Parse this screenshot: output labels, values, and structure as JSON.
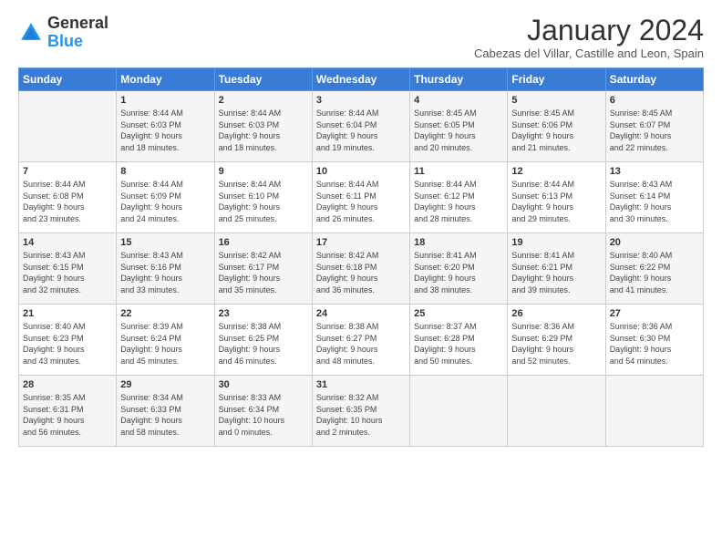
{
  "logo": {
    "line1": "General",
    "line2": "Blue"
  },
  "title": "January 2024",
  "subtitle": "Cabezas del Villar, Castille and Leon, Spain",
  "days_header": [
    "Sunday",
    "Monday",
    "Tuesday",
    "Wednesday",
    "Thursday",
    "Friday",
    "Saturday"
  ],
  "weeks": [
    [
      {
        "day": "",
        "info": ""
      },
      {
        "day": "1",
        "info": "Sunrise: 8:44 AM\nSunset: 6:03 PM\nDaylight: 9 hours\nand 18 minutes."
      },
      {
        "day": "2",
        "info": "Sunrise: 8:44 AM\nSunset: 6:03 PM\nDaylight: 9 hours\nand 18 minutes."
      },
      {
        "day": "3",
        "info": "Sunrise: 8:44 AM\nSunset: 6:04 PM\nDaylight: 9 hours\nand 19 minutes."
      },
      {
        "day": "4",
        "info": "Sunrise: 8:45 AM\nSunset: 6:05 PM\nDaylight: 9 hours\nand 20 minutes."
      },
      {
        "day": "5",
        "info": "Sunrise: 8:45 AM\nSunset: 6:06 PM\nDaylight: 9 hours\nand 21 minutes."
      },
      {
        "day": "6",
        "info": "Sunrise: 8:45 AM\nSunset: 6:07 PM\nDaylight: 9 hours\nand 22 minutes."
      }
    ],
    [
      {
        "day": "7",
        "info": "Sunrise: 8:44 AM\nSunset: 6:08 PM\nDaylight: 9 hours\nand 23 minutes."
      },
      {
        "day": "8",
        "info": "Sunrise: 8:44 AM\nSunset: 6:09 PM\nDaylight: 9 hours\nand 24 minutes."
      },
      {
        "day": "9",
        "info": "Sunrise: 8:44 AM\nSunset: 6:10 PM\nDaylight: 9 hours\nand 25 minutes."
      },
      {
        "day": "10",
        "info": "Sunrise: 8:44 AM\nSunset: 6:11 PM\nDaylight: 9 hours\nand 26 minutes."
      },
      {
        "day": "11",
        "info": "Sunrise: 8:44 AM\nSunset: 6:12 PM\nDaylight: 9 hours\nand 28 minutes."
      },
      {
        "day": "12",
        "info": "Sunrise: 8:44 AM\nSunset: 6:13 PM\nDaylight: 9 hours\nand 29 minutes."
      },
      {
        "day": "13",
        "info": "Sunrise: 8:43 AM\nSunset: 6:14 PM\nDaylight: 9 hours\nand 30 minutes."
      }
    ],
    [
      {
        "day": "14",
        "info": "Sunrise: 8:43 AM\nSunset: 6:15 PM\nDaylight: 9 hours\nand 32 minutes."
      },
      {
        "day": "15",
        "info": "Sunrise: 8:43 AM\nSunset: 6:16 PM\nDaylight: 9 hours\nand 33 minutes."
      },
      {
        "day": "16",
        "info": "Sunrise: 8:42 AM\nSunset: 6:17 PM\nDaylight: 9 hours\nand 35 minutes."
      },
      {
        "day": "17",
        "info": "Sunrise: 8:42 AM\nSunset: 6:18 PM\nDaylight: 9 hours\nand 36 minutes."
      },
      {
        "day": "18",
        "info": "Sunrise: 8:41 AM\nSunset: 6:20 PM\nDaylight: 9 hours\nand 38 minutes."
      },
      {
        "day": "19",
        "info": "Sunrise: 8:41 AM\nSunset: 6:21 PM\nDaylight: 9 hours\nand 39 minutes."
      },
      {
        "day": "20",
        "info": "Sunrise: 8:40 AM\nSunset: 6:22 PM\nDaylight: 9 hours\nand 41 minutes."
      }
    ],
    [
      {
        "day": "21",
        "info": "Sunrise: 8:40 AM\nSunset: 6:23 PM\nDaylight: 9 hours\nand 43 minutes."
      },
      {
        "day": "22",
        "info": "Sunrise: 8:39 AM\nSunset: 6:24 PM\nDaylight: 9 hours\nand 45 minutes."
      },
      {
        "day": "23",
        "info": "Sunrise: 8:38 AM\nSunset: 6:25 PM\nDaylight: 9 hours\nand 46 minutes."
      },
      {
        "day": "24",
        "info": "Sunrise: 8:38 AM\nSunset: 6:27 PM\nDaylight: 9 hours\nand 48 minutes."
      },
      {
        "day": "25",
        "info": "Sunrise: 8:37 AM\nSunset: 6:28 PM\nDaylight: 9 hours\nand 50 minutes."
      },
      {
        "day": "26",
        "info": "Sunrise: 8:36 AM\nSunset: 6:29 PM\nDaylight: 9 hours\nand 52 minutes."
      },
      {
        "day": "27",
        "info": "Sunrise: 8:36 AM\nSunset: 6:30 PM\nDaylight: 9 hours\nand 54 minutes."
      }
    ],
    [
      {
        "day": "28",
        "info": "Sunrise: 8:35 AM\nSunset: 6:31 PM\nDaylight: 9 hours\nand 56 minutes."
      },
      {
        "day": "29",
        "info": "Sunrise: 8:34 AM\nSunset: 6:33 PM\nDaylight: 9 hours\nand 58 minutes."
      },
      {
        "day": "30",
        "info": "Sunrise: 8:33 AM\nSunset: 6:34 PM\nDaylight: 10 hours\nand 0 minutes."
      },
      {
        "day": "31",
        "info": "Sunrise: 8:32 AM\nSunset: 6:35 PM\nDaylight: 10 hours\nand 2 minutes."
      },
      {
        "day": "",
        "info": ""
      },
      {
        "day": "",
        "info": ""
      },
      {
        "day": "",
        "info": ""
      }
    ]
  ]
}
